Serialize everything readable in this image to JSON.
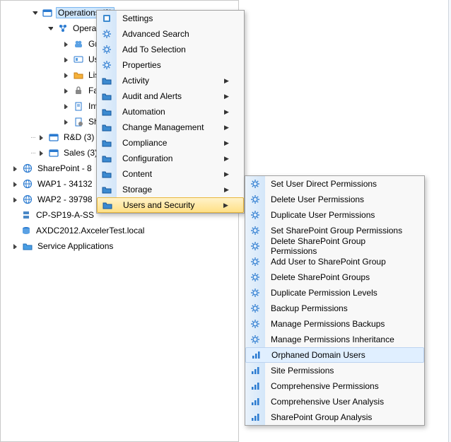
{
  "tree": {
    "operations": "Operations (3)",
    "operations2": "Operat",
    "groups": "Gro",
    "users": "Use",
    "lists": "List",
    "fac": "Fac",
    "inv": "Inv",
    "shi": "Shi",
    "rnd": "R&D (3)",
    "sales": "Sales (3)",
    "sharepoint": "SharePoint - 8",
    "wap1": "WAP1 - 34132",
    "wap2": "WAP2 - 39798",
    "cp": "CP-SP19-A-SS",
    "axdc": "AXDC2012.AxcelerTest.local",
    "svcapps": "Service Applications"
  },
  "menu1": {
    "settings": "Settings",
    "advanced_search": "Advanced Search",
    "add_to_selection": "Add To Selection",
    "properties": "Properties",
    "activity": "Activity",
    "audit": "Audit and Alerts",
    "automation": "Automation",
    "change_mgmt": "Change Management",
    "compliance": "Compliance",
    "configuration": "Configuration",
    "content": "Content",
    "storage": "Storage",
    "users_security": "Users and Security"
  },
  "menu2": {
    "set_user_direct": "Set User Direct Permissions",
    "delete_user_perm": "Delete User Permissions",
    "duplicate_user_perm": "Duplicate User Permissions",
    "set_sp_group_perm": "Set SharePoint Group Permissions",
    "delete_sp_group_perm": "Delete SharePoint Group Permissions",
    "add_user_sp_group": "Add User to SharePoint Group",
    "delete_sp_groups": "Delete SharePoint Groups",
    "duplicate_perm_levels": "Duplicate Permission Levels",
    "backup_perm": "Backup Permissions",
    "manage_perm_backups": "Manage Permissions Backups",
    "manage_perm_inherit": "Manage Permissions Inheritance",
    "orphaned_users": "Orphaned Domain Users",
    "site_perm": "Site Permissions",
    "comp_perm": "Comprehensive Permissions",
    "comp_user": "Comprehensive User Analysis",
    "sp_group_analysis": "SharePoint Group Analysis"
  }
}
